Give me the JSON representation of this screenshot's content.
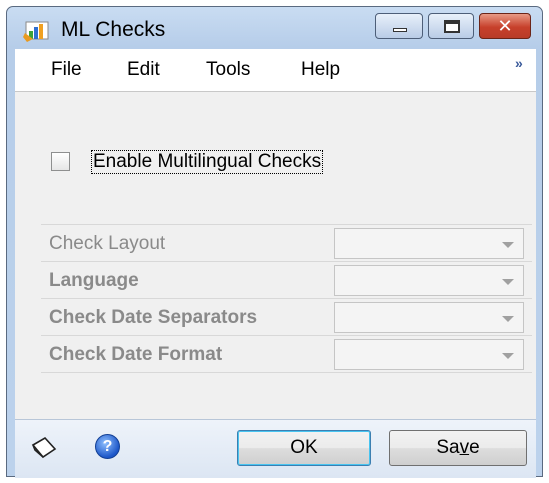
{
  "window": {
    "title": "ML  Checks"
  },
  "menu": {
    "items": [
      "File",
      "Edit",
      "Tools",
      "Help"
    ],
    "overflow": "»"
  },
  "enable": {
    "label": "Enable Multilingual Checks",
    "checked": false
  },
  "fields": [
    {
      "label": "Check Layout",
      "value": ""
    },
    {
      "label": "Language",
      "value": ""
    },
    {
      "label": "Check Date Separators",
      "value": ""
    },
    {
      "label": "Check Date Format",
      "value": ""
    }
  ],
  "buttons": {
    "ok": "OK",
    "save_prefix": "Sa",
    "save_mnemonic": "v",
    "save_suffix": "e"
  },
  "help_glyph": "?",
  "colors": {
    "titlebar": "#b6cde9",
    "close": "#c7402b",
    "disabled_text": "#8a8a8a"
  }
}
